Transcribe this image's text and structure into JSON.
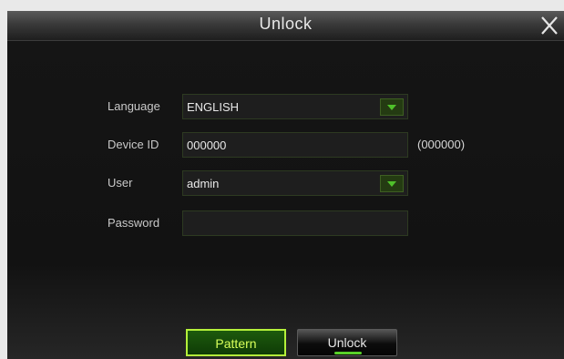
{
  "dialog": {
    "title": "Unlock"
  },
  "form": {
    "language": {
      "label": "Language",
      "value": "ENGLISH"
    },
    "device_id": {
      "label": "Device ID",
      "value": "000000",
      "hint": "(000000)"
    },
    "user": {
      "label": "User",
      "value": "admin"
    },
    "password": {
      "label": "Password",
      "value": ""
    }
  },
  "buttons": {
    "pattern": "Pattern",
    "unlock": "Unlock"
  },
  "colors": {
    "accent_green": "#4fc12a",
    "pattern_border": "#b4f03a",
    "background": "#101010"
  },
  "icons": {
    "close": "close-icon",
    "dropdown": "chevron-down-icon"
  }
}
